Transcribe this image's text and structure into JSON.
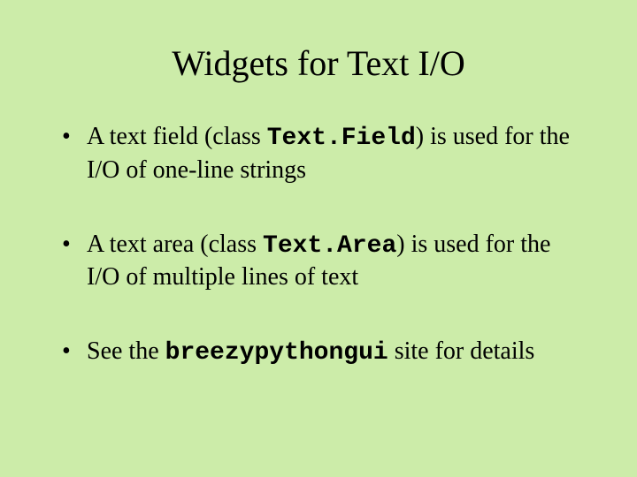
{
  "title": "Widgets for Text I/O",
  "bullets": [
    {
      "pre": "A text field (class ",
      "code": "Text.Field",
      "post": ") is used for the I/O of one-line strings"
    },
    {
      "pre": "A text area (class ",
      "code": "Text.Area",
      "post": ") is used for the I/O of multiple lines of text"
    },
    {
      "pre": "See the ",
      "code": "breezypythongui",
      "post": " site for details"
    }
  ]
}
